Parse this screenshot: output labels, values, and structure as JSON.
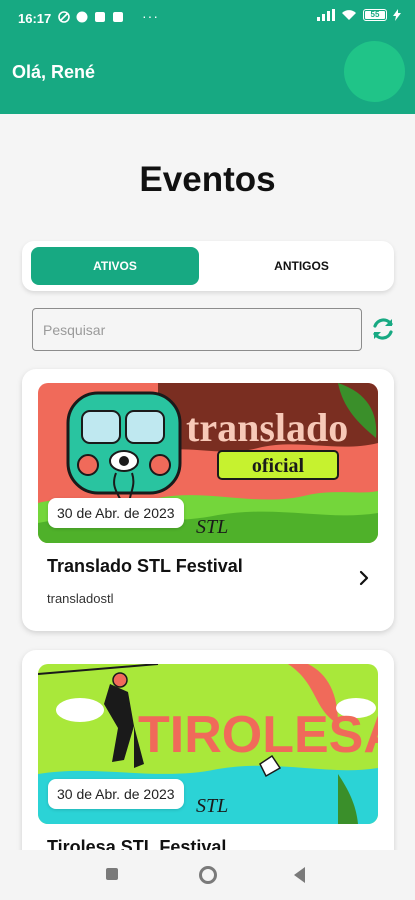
{
  "status": {
    "time": "16:17",
    "icons_left": [
      "notification-icon",
      "app-icon",
      "app-icon",
      "app-icon"
    ],
    "more": "···",
    "battery": "55"
  },
  "header": {
    "greeting": "Olá, René"
  },
  "page": {
    "title": "Eventos"
  },
  "tabs": {
    "active_label": "ATIVOS",
    "old_label": "ANTIGOS"
  },
  "search": {
    "placeholder": "Pesquisar"
  },
  "events": [
    {
      "date": "30 de Abr. de 2023",
      "title": "Translado STL Festival",
      "subtitle": "transladostl",
      "banner_text": "translado",
      "banner_sub": "oficial",
      "banner_mark": "STL"
    },
    {
      "date": "30 de Abr. de 2023",
      "title": "Tirolesa STL Festival",
      "banner_text": "TIROLESA",
      "banner_mark": "STL"
    }
  ],
  "colors": {
    "primary": "#17a982",
    "avatar": "#20c488"
  }
}
